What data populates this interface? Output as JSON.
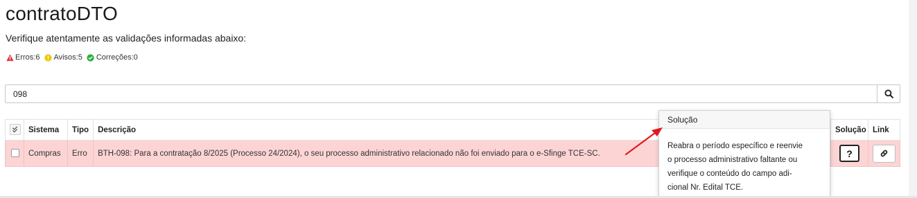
{
  "page": {
    "title": "contratoDTO",
    "subtitle": "Verifique atentamente as validações informadas abaixo:"
  },
  "counters": {
    "errors_label": "Erros:6",
    "warnings_label": "Avisos:5",
    "corrections_label": "Correções:0"
  },
  "search": {
    "value": "098"
  },
  "table": {
    "headers": {
      "select_all": "",
      "sistema": "Sistema",
      "tipo": "Tipo",
      "descricao": "Descrição",
      "solucao": "Solução",
      "link": "Link"
    },
    "rows": [
      {
        "sistema": "Compras",
        "tipo": "Erro",
        "descricao": "BTH-098: Para a contratação 8/2025 (Processo 24/2024), o seu processo administrativo relacionado não foi enviado para o e-Sfinge TCE-SC.",
        "solucao_label": "?"
      }
    ]
  },
  "popover": {
    "title": "Solução",
    "line1": "Reabra o período específico e reenvie",
    "line2": "o processo administrativo faltante ou",
    "line3": "verifique o conteúdo do campo adi-",
    "line4": "cional Nr. Edital TCE."
  },
  "colors": {
    "error": "#e0303d",
    "warning": "#e8c90a",
    "correction": "#2eae3f",
    "row_error_bg": "#fdd4d4",
    "annotation_arrow": "#e0191f"
  },
  "icons": {
    "errors": "warning-triangle-icon",
    "warnings": "exclamation-circle-icon",
    "corrections": "check-circle-icon",
    "search": "search-icon",
    "select_all": "double-check-icon",
    "link": "chain-link-icon"
  }
}
